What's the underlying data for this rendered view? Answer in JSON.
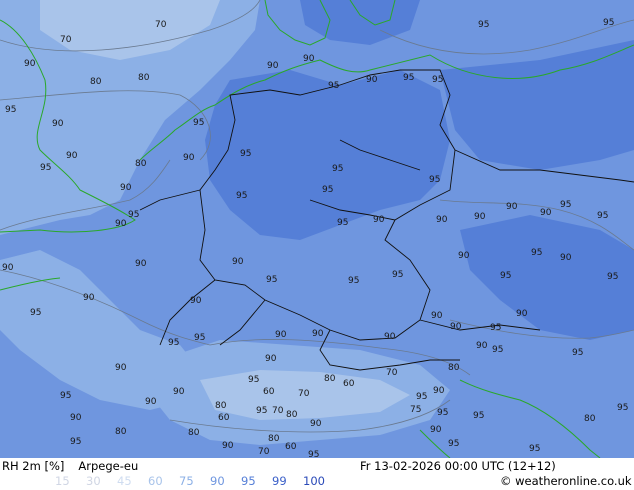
{
  "footer": {
    "variable": "RH 2m [%]",
    "model": "Arpege-eu",
    "valid_time": "Fr 13-02-2026 00:00 UTC (12+12)",
    "credit": "© weatheronline.co.uk"
  },
  "legend": {
    "values": [
      "15",
      "30",
      "45",
      "60",
      "75",
      "90",
      "95",
      "99",
      "100"
    ],
    "colors": [
      "#f5f5fa",
      "#e6ebf5",
      "#cfdcf0",
      "#a9c4ea",
      "#8cb0e6",
      "#6f96df",
      "#557fd7",
      "#3a5fc8",
      "#2a4ab8"
    ]
  },
  "map_colors": {
    "rh_60_75": "#a9c4ea",
    "rh_75_90": "#8cb0e6",
    "rh_90_95": "#6f96df",
    "rh_95_99": "#557fd7",
    "coastline": "#2aa82a",
    "border": "#101010",
    "contour": "#6a7a90"
  },
  "contour_labels": [
    "70",
    "80",
    "90",
    "95",
    "60",
    "75"
  ]
}
